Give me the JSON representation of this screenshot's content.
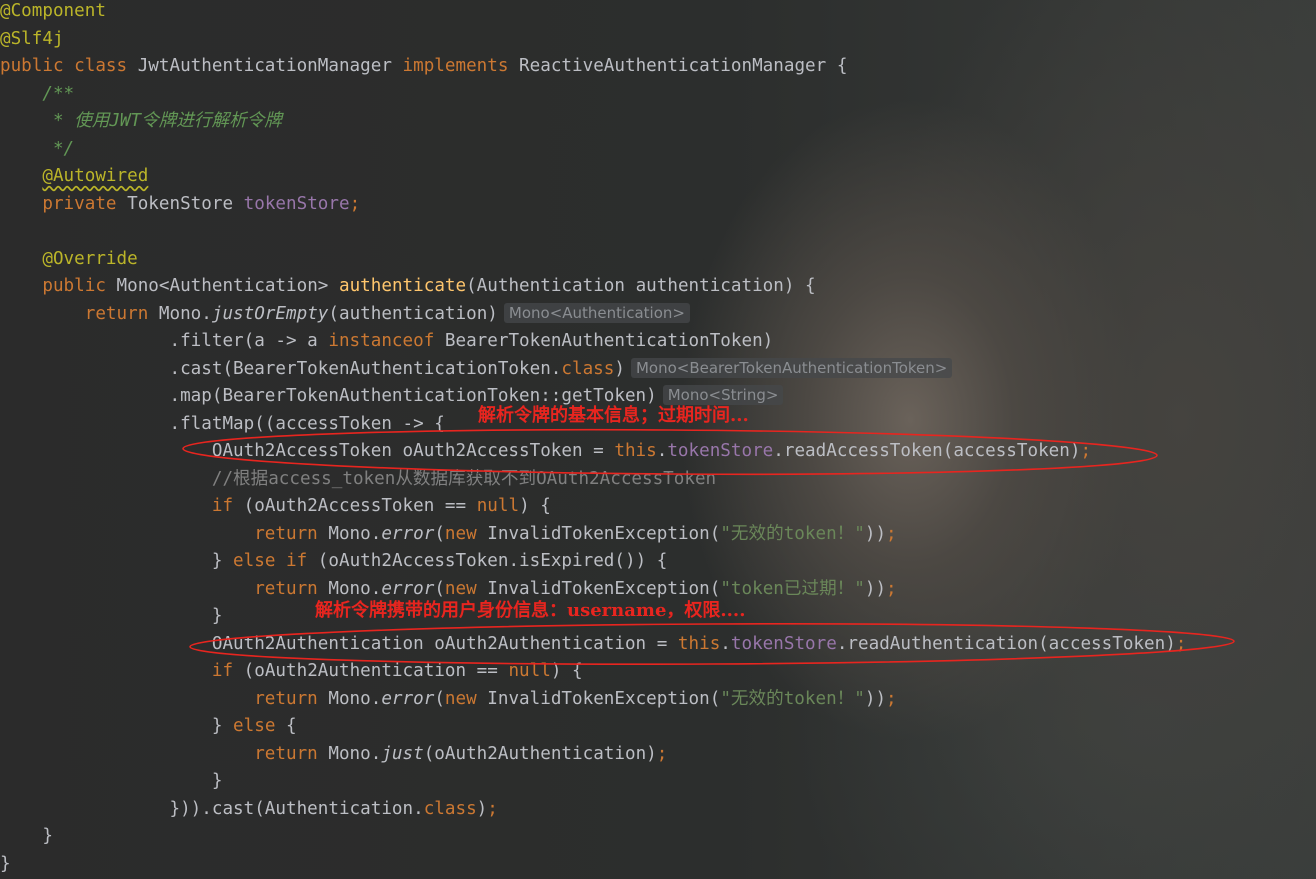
{
  "editor": {
    "lines": [
      [
        {
          "t": "@Component",
          "c": "ann"
        }
      ],
      [
        {
          "t": "@Slf4j",
          "c": "ann"
        }
      ],
      [
        {
          "t": "public class ",
          "c": "kw"
        },
        {
          "t": "JwtAuthenticationManager "
        },
        {
          "t": "implements ",
          "c": "kw"
        },
        {
          "t": "ReactiveAuthenticationManager {"
        }
      ],
      [
        {
          "t": "    "
        },
        {
          "t": "/**",
          "c": "doc"
        }
      ],
      [
        {
          "t": "     * 使用JWT令牌进行解析令牌",
          "c": "doc"
        }
      ],
      [
        {
          "t": "     */",
          "c": "doc"
        }
      ],
      [
        {
          "t": "    "
        },
        {
          "t": "@Autowired",
          "c": "ann warn"
        }
      ],
      [
        {
          "t": "    "
        },
        {
          "t": "private ",
          "c": "kw"
        },
        {
          "t": "TokenStore "
        },
        {
          "t": "tokenStore",
          "c": "fld"
        },
        {
          "t": ";",
          "c": "kw"
        }
      ],
      [],
      [
        {
          "t": "    "
        },
        {
          "t": "@Override",
          "c": "ann"
        }
      ],
      [
        {
          "t": "    "
        },
        {
          "t": "public ",
          "c": "kw"
        },
        {
          "t": "Mono<Authentication> "
        },
        {
          "t": "authenticate",
          "c": "fn"
        },
        {
          "t": "(Authentication authentication) {"
        }
      ],
      [
        {
          "t": "        "
        },
        {
          "t": "return ",
          "c": "kw"
        },
        {
          "t": "Mono."
        },
        {
          "t": "justOrEmpty",
          "c": "it"
        },
        {
          "t": "(authentication)"
        },
        {
          "hint": "Mono<Authentication>"
        }
      ],
      [
        {
          "t": "                .filter(a -> a "
        },
        {
          "t": "instanceof ",
          "c": "kw"
        },
        {
          "t": "BearerTokenAuthenticationToken)"
        }
      ],
      [
        {
          "t": "                .cast(BearerTokenAuthenticationToken."
        },
        {
          "t": "class",
          "c": "kw"
        },
        {
          "t": ")"
        },
        {
          "hint": "Mono<BearerTokenAuthenticationToken>"
        }
      ],
      [
        {
          "t": "                .map(BearerTokenAuthenticationToken::getToken)"
        },
        {
          "hint": "Mono<String>"
        }
      ],
      [
        {
          "t": "                .flatMap((accessToken -> {"
        }
      ],
      [
        {
          "t": "                    OAuth2AccessToken oAuth2AccessToken = "
        },
        {
          "t": "this",
          "c": "kw"
        },
        {
          "t": "."
        },
        {
          "t": "tokenStore",
          "c": "fld"
        },
        {
          "t": ".readAccessToken(accessToken)"
        },
        {
          "t": ";",
          "c": "kw"
        }
      ],
      [
        {
          "t": "                    //根据access_token从数据库获取不到OAuth2AccessToken",
          "c": "cmt"
        }
      ],
      [
        {
          "t": "                    "
        },
        {
          "t": "if ",
          "c": "kw"
        },
        {
          "t": "(oAuth2AccessToken == "
        },
        {
          "t": "null",
          "c": "kw"
        },
        {
          "t": ") {"
        }
      ],
      [
        {
          "t": "                        "
        },
        {
          "t": "return ",
          "c": "kw"
        },
        {
          "t": "Mono."
        },
        {
          "t": "error",
          "c": "it"
        },
        {
          "t": "("
        },
        {
          "t": "new ",
          "c": "kw"
        },
        {
          "t": "InvalidTokenException("
        },
        {
          "t": "\"无效的token！\"",
          "c": "str"
        },
        {
          "t": "))"
        },
        {
          "t": ";",
          "c": "kw"
        }
      ],
      [
        {
          "t": "                    } "
        },
        {
          "t": "else if ",
          "c": "kw"
        },
        {
          "t": "(oAuth2AccessToken.isExpired()) {"
        }
      ],
      [
        {
          "t": "                        "
        },
        {
          "t": "return ",
          "c": "kw"
        },
        {
          "t": "Mono."
        },
        {
          "t": "error",
          "c": "it"
        },
        {
          "t": "("
        },
        {
          "t": "new ",
          "c": "kw"
        },
        {
          "t": "InvalidTokenException("
        },
        {
          "t": "\"token已过期！\"",
          "c": "str"
        },
        {
          "t": "))"
        },
        {
          "t": ";",
          "c": "kw"
        }
      ],
      [
        {
          "t": "                    }"
        }
      ],
      [
        {
          "t": "                    OAuth2Authentication oAuth2Authentication = "
        },
        {
          "t": "this",
          "c": "kw"
        },
        {
          "t": "."
        },
        {
          "t": "tokenStore",
          "c": "fld"
        },
        {
          "t": ".readAuthentication(accessToken)"
        },
        {
          "t": ";",
          "c": "kw"
        }
      ],
      [
        {
          "t": "                    "
        },
        {
          "t": "if ",
          "c": "kw"
        },
        {
          "t": "(oAuth2Authentication == "
        },
        {
          "t": "null",
          "c": "kw"
        },
        {
          "t": ") {"
        }
      ],
      [
        {
          "t": "                        "
        },
        {
          "t": "return ",
          "c": "kw"
        },
        {
          "t": "Mono."
        },
        {
          "t": "error",
          "c": "it"
        },
        {
          "t": "("
        },
        {
          "t": "new ",
          "c": "kw"
        },
        {
          "t": "InvalidTokenException("
        },
        {
          "t": "\"无效的token！\"",
          "c": "str"
        },
        {
          "t": "))"
        },
        {
          "t": ";",
          "c": "kw"
        }
      ],
      [
        {
          "t": "                    } "
        },
        {
          "t": "else ",
          "c": "kw"
        },
        {
          "t": "{"
        }
      ],
      [
        {
          "t": "                        "
        },
        {
          "t": "return ",
          "c": "kw"
        },
        {
          "t": "Mono."
        },
        {
          "t": "just",
          "c": "it"
        },
        {
          "t": "(oAuth2Authentication)"
        },
        {
          "t": ";",
          "c": "kw"
        }
      ],
      [
        {
          "t": "                    }"
        }
      ],
      [
        {
          "t": "                })).cast(Authentication."
        },
        {
          "t": "class",
          "c": "kw"
        },
        {
          "t": ")"
        },
        {
          "t": ";",
          "c": "kw"
        }
      ],
      [
        {
          "t": "    }"
        }
      ],
      [
        {
          "t": "}"
        }
      ]
    ]
  },
  "annotations": {
    "note1": "解析令牌的基本信息；过期时间...",
    "note2": "解析令牌携带的用户身份信息：username，权限...."
  },
  "colors": {
    "keyword": "#cc7832",
    "annotation": "#bbb529",
    "method": "#ffc66d",
    "field": "#9876aa",
    "string": "#6a8759",
    "doc_comment": "#629755",
    "comment": "#808080",
    "text": "#bcbec4",
    "markup_red": "#e8251f"
  }
}
